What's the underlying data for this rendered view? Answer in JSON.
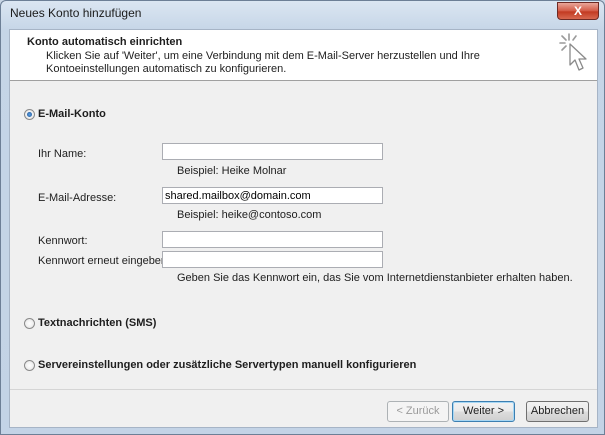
{
  "window": {
    "title": "Neues Konto hinzufügen",
    "close_glyph": "X"
  },
  "header": {
    "title": "Konto automatisch einrichten",
    "description": "Klicken Sie auf 'Weiter', um eine Verbindung mit dem E-Mail-Server herzustellen und Ihre Kontoeinstellungen automatisch zu konfigurieren.",
    "icon": "cursor-sparkle-icon"
  },
  "options": {
    "email_account": {
      "label": "E-Mail-Konto",
      "selected": true
    },
    "sms": {
      "label": "Textnachrichten (SMS)",
      "selected": false
    },
    "manual": {
      "label": "Servereinstellungen oder zusätzliche Servertypen manuell konfigurieren",
      "selected": false
    }
  },
  "form": {
    "name_label": "Ihr Name:",
    "name_value": "",
    "name_example": "Beispiel: Heike Molnar",
    "email_label": "E-Mail-Adresse:",
    "email_value": "shared.mailbox@domain.com",
    "email_example": "Beispiel: heike@contoso.com",
    "password_label": "Kennwort:",
    "password_value": "",
    "password_repeat_label": "Kennwort erneut eingeben:",
    "password_repeat_value": "",
    "password_hint": "Geben Sie das Kennwort ein, das Sie vom Internetdienstanbieter erhalten haben."
  },
  "buttons": {
    "back": "< Zurück",
    "next": "Weiter >",
    "cancel": "Abbrechen"
  },
  "colors": {
    "close_red": "#c23a22",
    "default_button_border": "#3c7fb1"
  }
}
